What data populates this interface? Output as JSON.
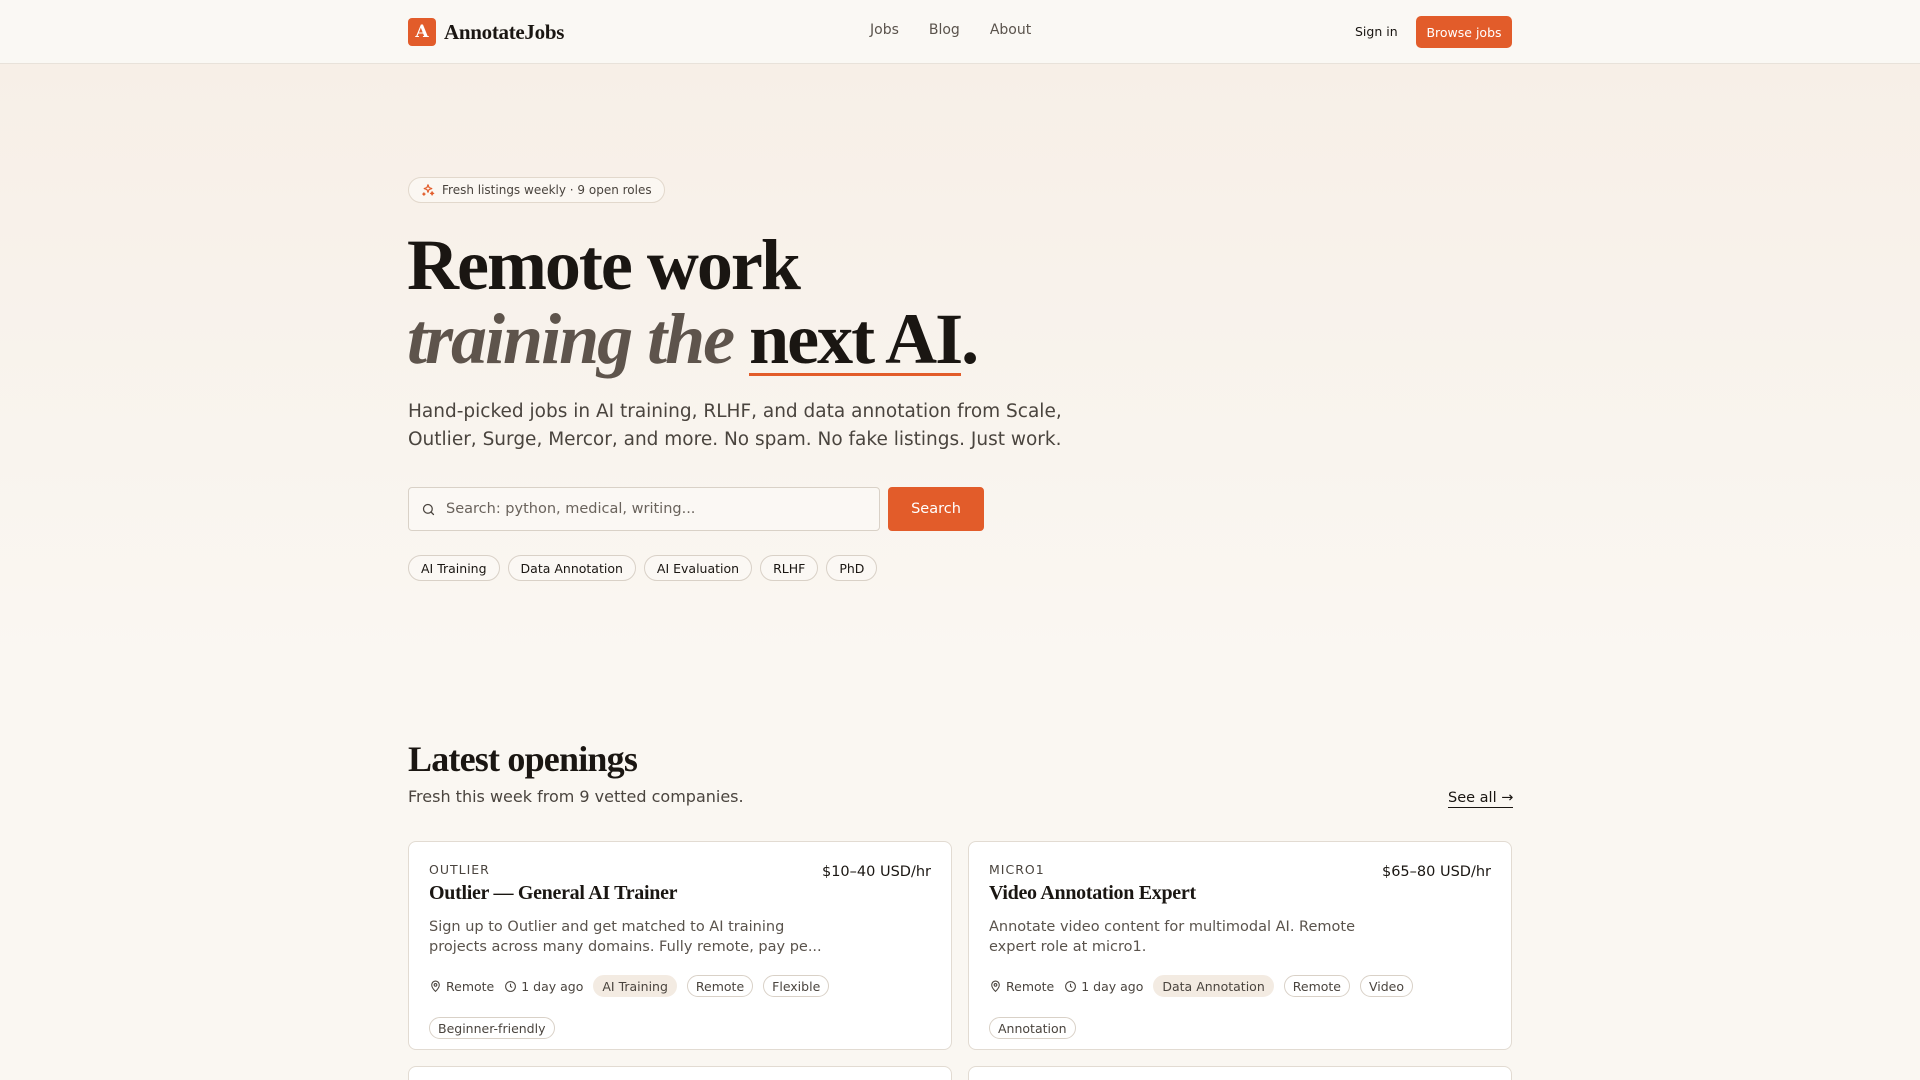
{
  "header": {
    "logo_letter": "A",
    "brand": "AnnotateJobs",
    "nav": [
      "Jobs",
      "Blog",
      "About"
    ],
    "sign_in": "Sign in",
    "browse_jobs": "Browse jobs"
  },
  "hero": {
    "pill": "Fresh listings weekly · 9 open roles",
    "headline_line1": "Remote work",
    "headline_italic": "training the",
    "headline_underlined": "next AI",
    "headline_period": ".",
    "subtitle": "Hand-picked jobs in AI training, RLHF, and data annotation from Scale, Outlier, Surge, Mercor, and more. No spam. No fake listings. Just work.",
    "search_placeholder": "Search: python, medical, writing...",
    "search_button": "Search",
    "chips": [
      "AI Training",
      "Data Annotation",
      "AI Evaluation",
      "RLHF",
      "PhD"
    ]
  },
  "latest": {
    "title": "Latest openings",
    "subtitle": "Fresh this week from 9 vetted companies.",
    "see_all": "See all →",
    "jobs": [
      {
        "company": "OUTLIER",
        "title": "Outlier — General AI Trainer",
        "pay": "$10–40 USD/hr",
        "description": "Sign up to Outlier and get matched to AI training projects across many domains. Fully remote, pay pe...",
        "location": "Remote",
        "posted": "1 day ago",
        "category": "AI Training",
        "tags": [
          "Remote",
          "Flexible",
          "Beginner-friendly"
        ]
      },
      {
        "company": "MICRO1",
        "title": "Video Annotation Expert",
        "pay": "$65–80 USD/hr",
        "description": "Annotate video content for multimodal AI. Remote expert role at micro1.",
        "location": "Remote",
        "posted": "1 day ago",
        "category": "Data Annotation",
        "tags": [
          "Remote",
          "Video",
          "Annotation"
        ]
      }
    ]
  },
  "colors": {
    "accent": "#e25c2a",
    "background": "#faf7f2",
    "text": "#1a1612"
  }
}
